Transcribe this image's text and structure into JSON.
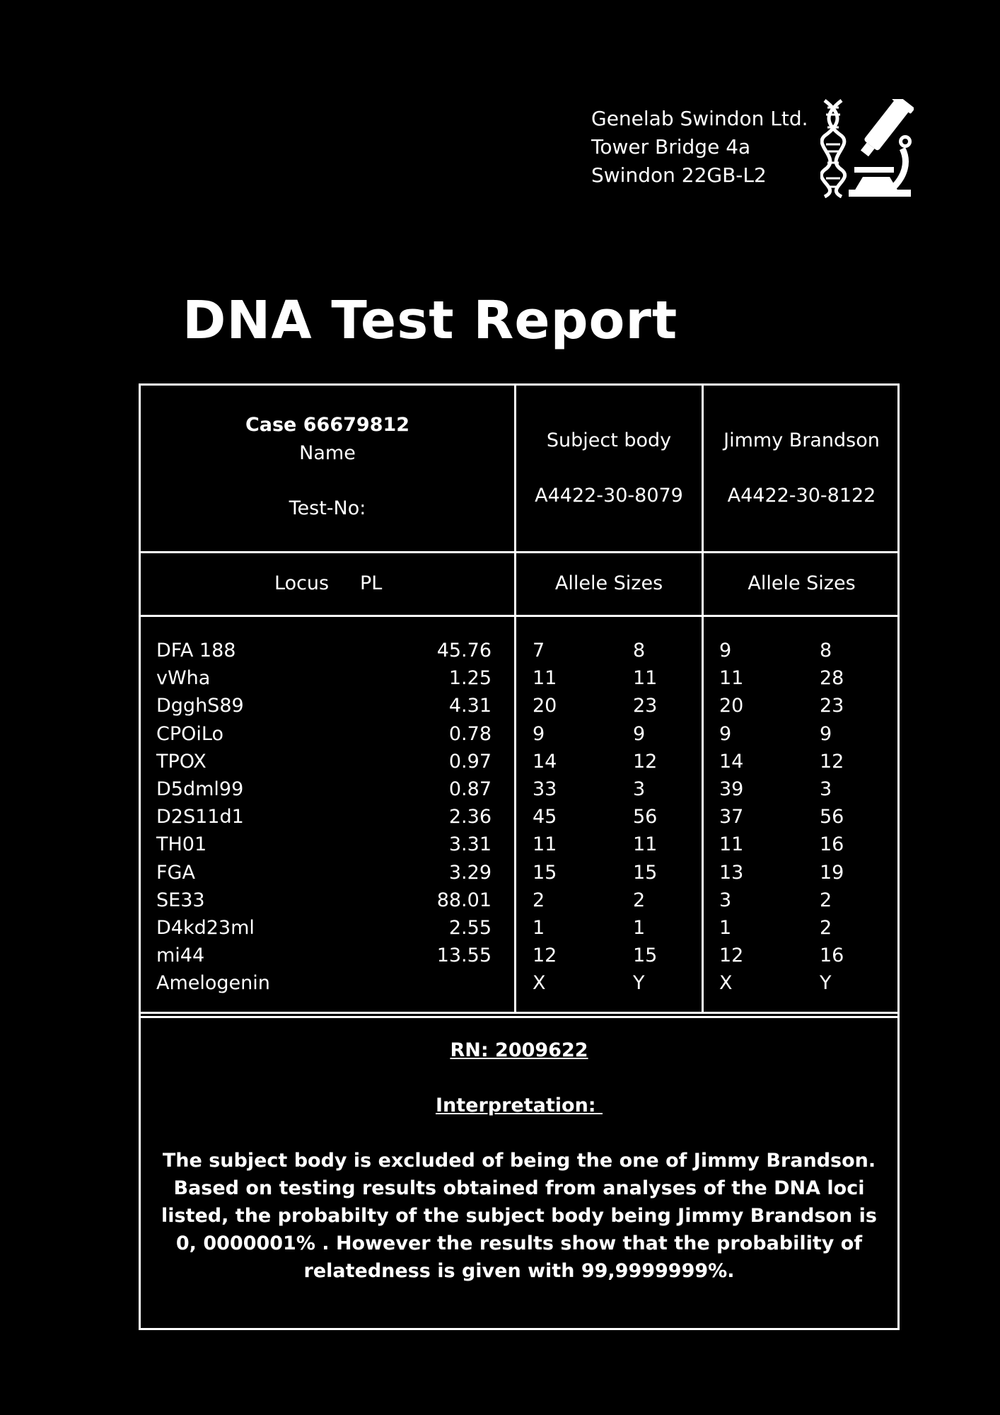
{
  "header": {
    "address_lines": [
      "Genelab Swindon Ltd.",
      "Tower Bridge 4a",
      "Swindon 22GB-L2"
    ],
    "logo_icon": "dna-microscope-icon"
  },
  "title": "DNA Test Report",
  "table": {
    "case_label": "Case 66679812",
    "name_label": "Name",
    "testno_label": "Test-No:",
    "subject": {
      "name": "Subject body",
      "test_no": "A4422-30-8079"
    },
    "person": {
      "name": "Jimmy Brandson",
      "test_no": "A4422-30-8122"
    },
    "locus_header": "Locus",
    "pl_header": "PL",
    "allele_header_1": "Allele Sizes",
    "allele_header_2": "Allele Sizes",
    "rows": [
      {
        "locus": "DFA 188",
        "pl": "45.76",
        "s1": "7",
        "s2": "8",
        "p1": "9",
        "p2": "8"
      },
      {
        "locus": "vWha",
        "pl": "1.25",
        "s1": "11",
        "s2": "11",
        "p1": "11",
        "p2": "28"
      },
      {
        "locus": "DgghS89",
        "pl": "4.31",
        "s1": "20",
        "s2": "23",
        "p1": "20",
        "p2": "23"
      },
      {
        "locus": "CPOiLo",
        "pl": "0.78",
        "s1": "9",
        "s2": "9",
        "p1": "9",
        "p2": "9"
      },
      {
        "locus": "TPOX",
        "pl": "0.97",
        "s1": "14",
        "s2": "12",
        "p1": "14",
        "p2": "12"
      },
      {
        "locus": "D5dml99",
        "pl": "0.87",
        "s1": "33",
        "s2": "3",
        "p1": "39",
        "p2": "3"
      },
      {
        "locus": "D2S11d1",
        "pl": "2.36",
        "s1": "45",
        "s2": "56",
        "p1": "37",
        "p2": "56"
      },
      {
        "locus": "TH01",
        "pl": "3.31",
        "s1": "11",
        "s2": "11",
        "p1": "11",
        "p2": "16"
      },
      {
        "locus": "FGA",
        "pl": "3.29",
        "s1": "15",
        "s2": "15",
        "p1": "13",
        "p2": "19"
      },
      {
        "locus": "SE33",
        "pl": "88.01",
        "s1": "2",
        "s2": "2",
        "p1": "3",
        "p2": "2"
      },
      {
        "locus": "D4kd23ml",
        "pl": "2.55",
        "s1": "1",
        "s2": "1",
        "p1": "1",
        "p2": "2"
      },
      {
        "locus": "mi44",
        "pl": "13.55",
        "s1": "12",
        "s2": "15",
        "p1": "12",
        "p2": "16"
      },
      {
        "locus": "Amelogenin",
        "pl": "",
        "s1": "X",
        "s2": "Y",
        "p1": "X",
        "p2": "Y"
      }
    ],
    "rn": "RN: 2009622",
    "interpretation_label": "Interpretation: ",
    "interpretation_text": "The subject body is excluded of being the one of Jimmy Brandson. Based on testing results obtained from analyses of the DNA loci listed, the probabilty of the subject body being Jimmy Brandson is 0, 0000001% . However the results show that the probability of relatedness is given with 99,9999999%."
  }
}
